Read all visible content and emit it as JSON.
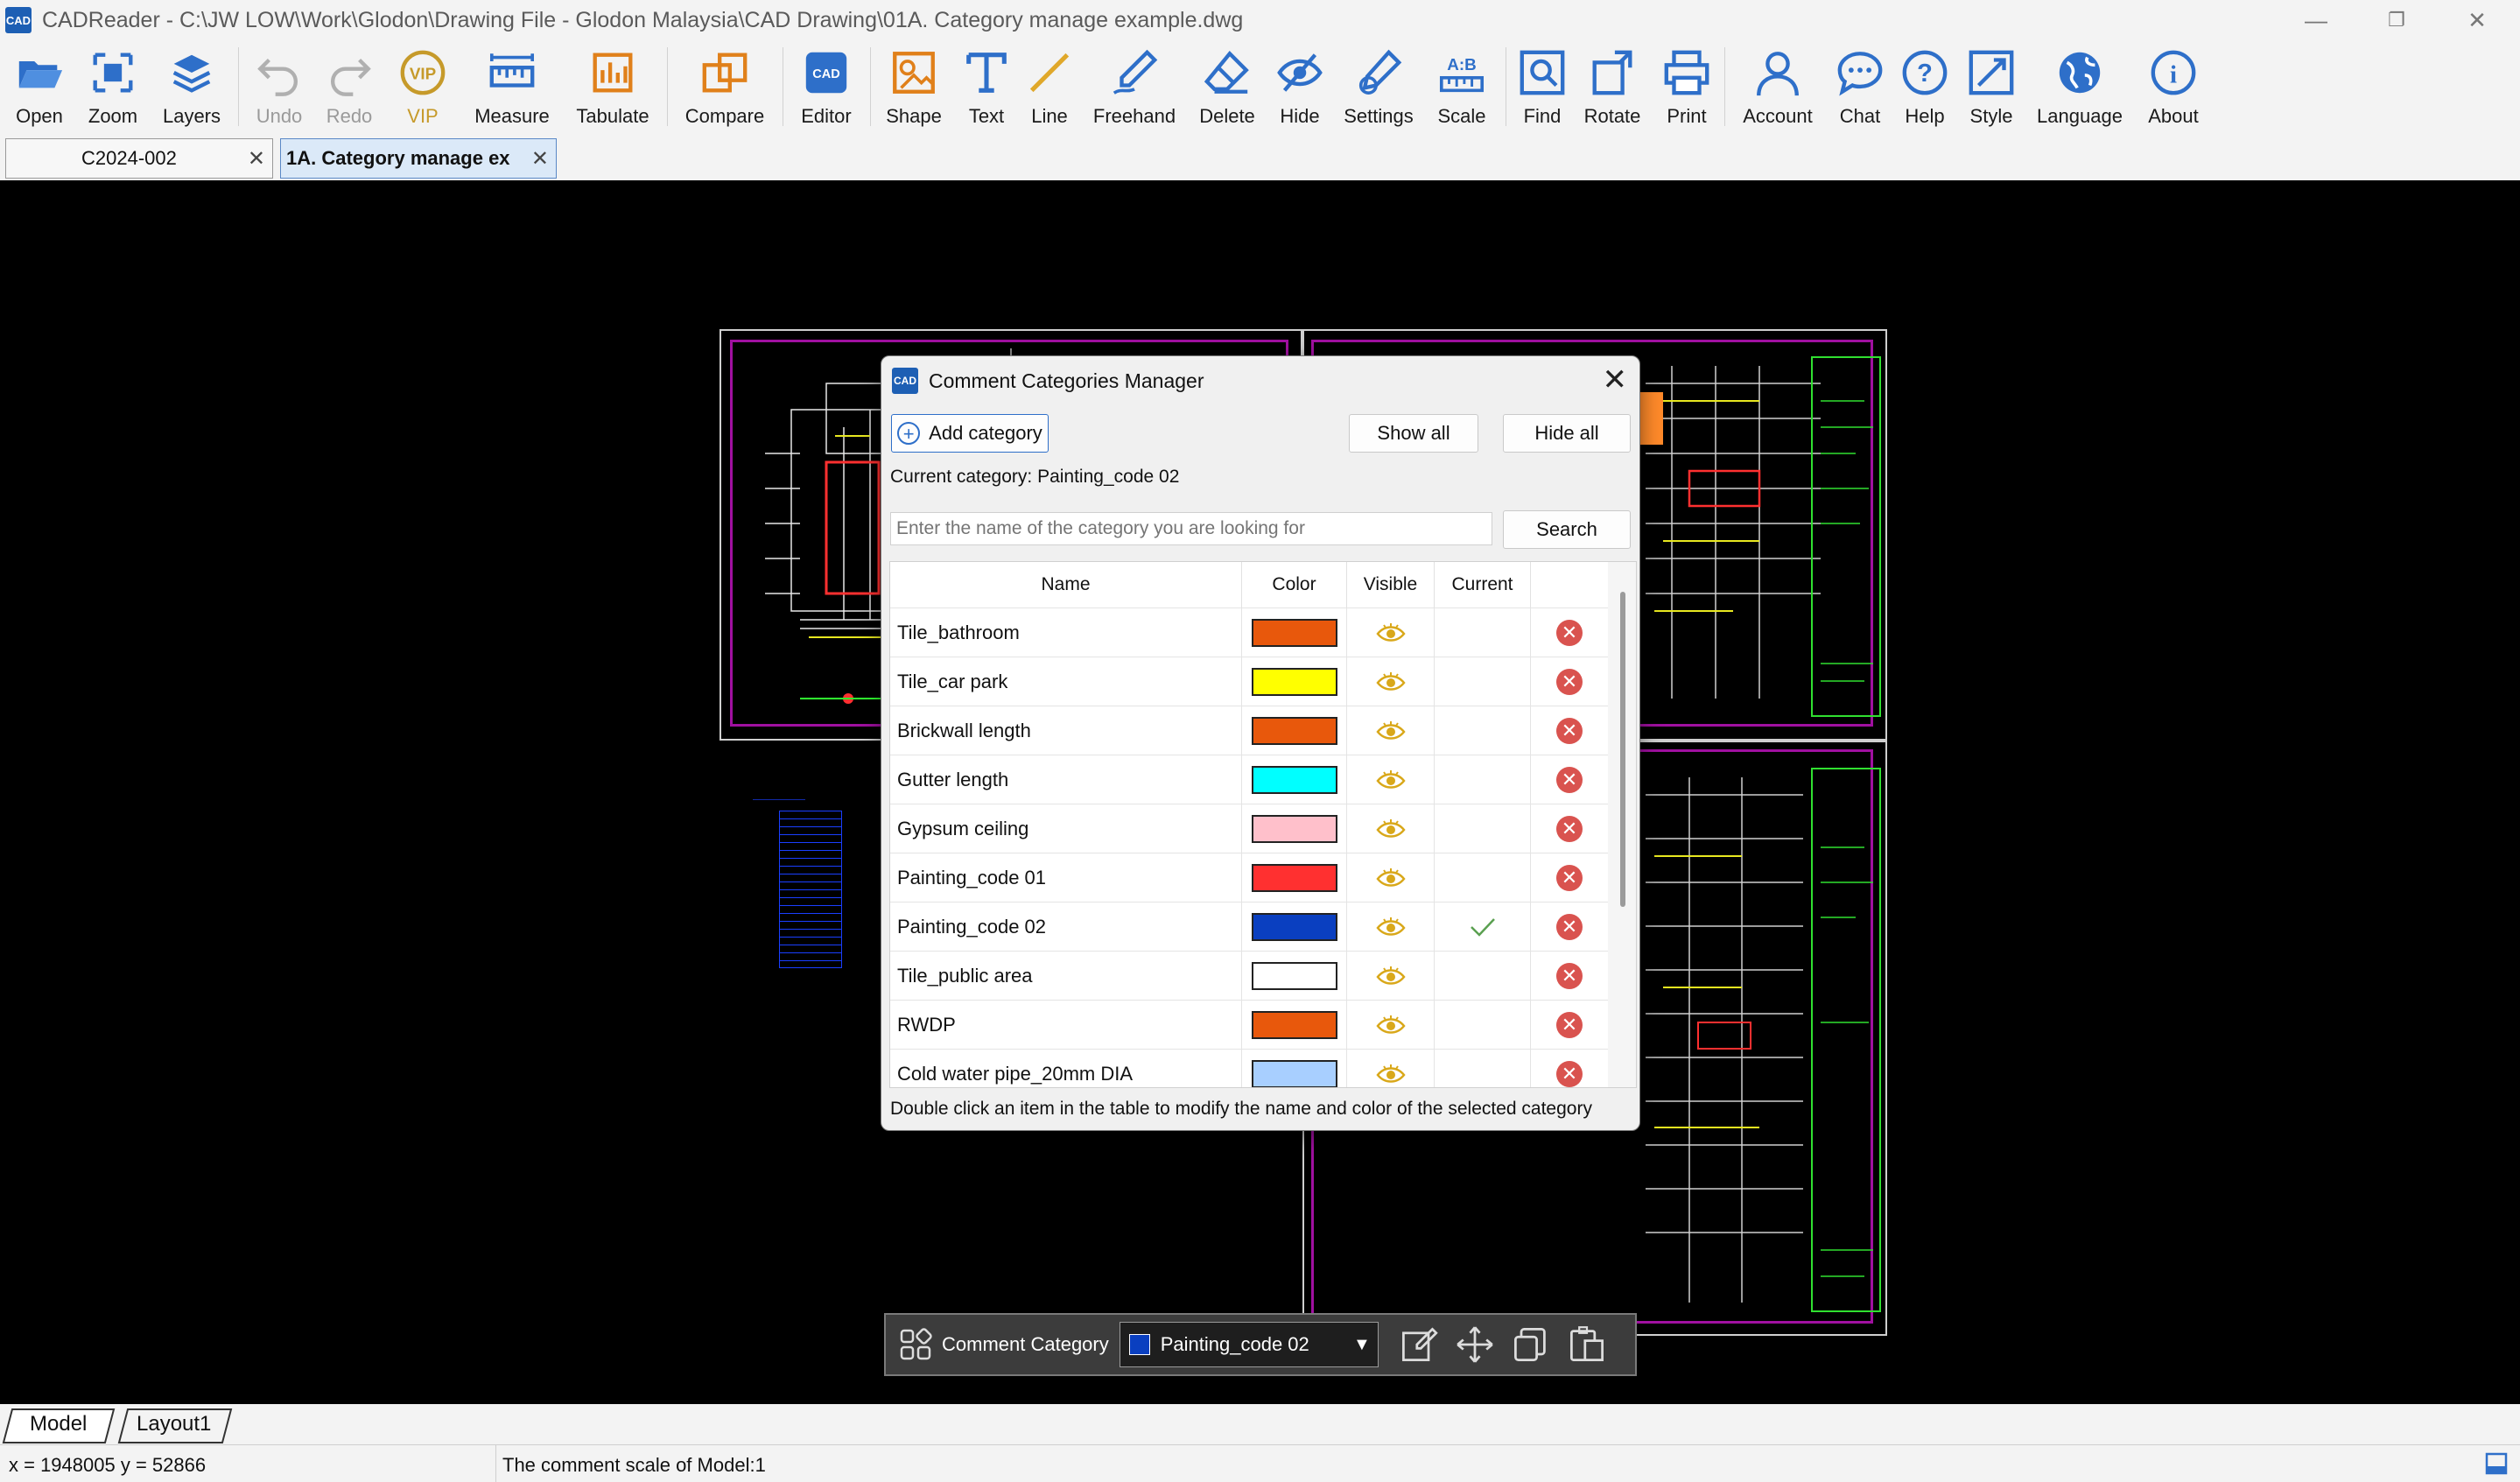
{
  "app": {
    "title": "CADReader - C:\\JW LOW\\Work\\Glodon\\Drawing File - Glodon Malaysia\\CAD Drawing\\01A. Category manage example.dwg",
    "logo_text": "CAD"
  },
  "toolbar": {
    "items": [
      {
        "label": "Open",
        "icon": "folder-open-icon"
      },
      {
        "label": "Zoom",
        "icon": "zoom-icon"
      },
      {
        "label": "Layers",
        "icon": "layers-icon"
      },
      {
        "label": "Undo",
        "icon": "undo-icon"
      },
      {
        "label": "Redo",
        "icon": "redo-icon"
      },
      {
        "label": "VIP",
        "icon": "vip-icon"
      },
      {
        "label": "Measure",
        "icon": "measure-icon"
      },
      {
        "label": "Tabulate",
        "icon": "tabulate-icon"
      },
      {
        "label": "Compare",
        "icon": "compare-icon"
      },
      {
        "label": "Editor",
        "icon": "editor-icon"
      },
      {
        "label": "Shape",
        "icon": "shape-icon"
      },
      {
        "label": "Text",
        "icon": "text-icon"
      },
      {
        "label": "Line",
        "icon": "line-icon"
      },
      {
        "label": "Freehand",
        "icon": "freehand-icon"
      },
      {
        "label": "Delete",
        "icon": "eraser-icon"
      },
      {
        "label": "Hide",
        "icon": "hide-icon"
      },
      {
        "label": "Settings",
        "icon": "settings-icon"
      },
      {
        "label": "Scale",
        "icon": "scale-icon"
      },
      {
        "label": "Find",
        "icon": "find-icon"
      },
      {
        "label": "Rotate",
        "icon": "rotate-icon"
      },
      {
        "label": "Print",
        "icon": "print-icon"
      },
      {
        "label": "Account",
        "icon": "account-icon"
      },
      {
        "label": "Chat",
        "icon": "chat-icon"
      },
      {
        "label": "Help",
        "icon": "help-icon"
      },
      {
        "label": "Style",
        "icon": "style-icon"
      },
      {
        "label": "Language",
        "icon": "globe-icon"
      },
      {
        "label": "About",
        "icon": "info-icon"
      }
    ],
    "scale_glyph": "A:B"
  },
  "tabs": [
    {
      "label": "C2024-002",
      "active": false
    },
    {
      "label": "1A. Category manage ex",
      "active": true
    }
  ],
  "dialog": {
    "title": "Comment Categories Manager",
    "add_label": "Add category",
    "show_all_label": "Show all",
    "hide_all_label": "Hide all",
    "current_category_text": "Current category: Painting_code 02",
    "search_placeholder": "Enter the name of the category you are looking for",
    "search_label": "Search",
    "columns": {
      "name": "Name",
      "color": "Color",
      "visible": "Visible",
      "current": "Current"
    },
    "rows": [
      {
        "name": "Tile_bathroom",
        "color": "#e8580c",
        "visible": true,
        "current": false
      },
      {
        "name": "Tile_car park",
        "color": "#ffff00",
        "visible": true,
        "current": false
      },
      {
        "name": "Brickwall length",
        "color": "#e8580c",
        "visible": true,
        "current": false
      },
      {
        "name": "Gutter length",
        "color": "#00ffff",
        "visible": true,
        "current": false
      },
      {
        "name": "Gypsum ceiling",
        "color": "#ffc0cb",
        "visible": true,
        "current": false
      },
      {
        "name": "Painting_code 01",
        "color": "#ff3030",
        "visible": true,
        "current": false
      },
      {
        "name": "Painting_code 02",
        "color": "#0a3fc0",
        "visible": true,
        "current": true
      },
      {
        "name": "Tile_public area",
        "color": "#ffffff",
        "visible": true,
        "current": false
      },
      {
        "name": "RWDP",
        "color": "#e8580c",
        "visible": true,
        "current": false
      },
      {
        "name": "Cold water pipe_20mm DIA",
        "color": "#a8cfff",
        "visible": true,
        "current": false
      }
    ],
    "hint": "Double click an item in the table to modify the name and color of the selected category"
  },
  "comment_bar": {
    "label": "Comment Category",
    "selected": "Painting_code 02",
    "selected_color": "#0a3fc0"
  },
  "layout_tabs": [
    {
      "label": "Model",
      "active": true
    },
    {
      "label": "Layout1",
      "active": false
    }
  ],
  "status": {
    "coords": "x = 1948005  y = 52866",
    "scale_text": "The comment scale of Model:1"
  },
  "colors": {
    "accent": "#1d5fb4",
    "annotation_arrow": "#e00000",
    "drawing_frame": "#a010a0"
  }
}
